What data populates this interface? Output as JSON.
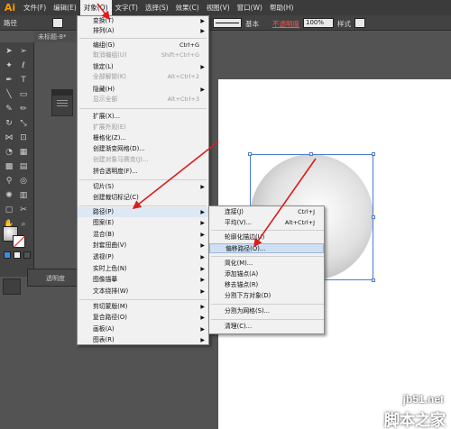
{
  "menubar": {
    "logo": "Ai",
    "items": [
      "文件(F)",
      "编辑(E)",
      "对象(O)",
      "文字(T)",
      "选择(S)",
      "效果(C)",
      "视图(V)",
      "窗口(W)",
      "帮助(H)"
    ]
  },
  "controlbar": {
    "path_label": "路径",
    "stroke_style": "基本",
    "opacity_label": "不透明度",
    "opacity_value": "100%",
    "style_label": "样式"
  },
  "doc_tab": "未标题-8*",
  "panels": {
    "transparency_tab": "透明度"
  },
  "object_menu": {
    "items": [
      {
        "label": "变换(T)",
        "shortcut": "",
        "submenu": true,
        "disabled": false
      },
      {
        "label": "排列(A)",
        "shortcut": "",
        "submenu": true,
        "disabled": false
      },
      {
        "label": "编组(G)",
        "shortcut": "Ctrl+G",
        "submenu": false,
        "disabled": false
      },
      {
        "label": "取消编组(U)",
        "shortcut": "Shift+Ctrl+G",
        "submenu": false,
        "disabled": true
      },
      {
        "label": "锁定(L)",
        "shortcut": "",
        "submenu": true,
        "disabled": false
      },
      {
        "label": "全部解锁(K)",
        "shortcut": "Alt+Ctrl+2",
        "submenu": false,
        "disabled": true
      },
      {
        "label": "隐藏(H)",
        "shortcut": "",
        "submenu": true,
        "disabled": false
      },
      {
        "label": "显示全部",
        "shortcut": "Alt+Ctrl+3",
        "submenu": false,
        "disabled": true
      },
      {
        "label": "扩展(X)...",
        "shortcut": "",
        "submenu": false,
        "disabled": false
      },
      {
        "label": "扩展外观(E)",
        "shortcut": "",
        "submenu": false,
        "disabled": true
      },
      {
        "label": "栅格化(Z)...",
        "shortcut": "",
        "submenu": false,
        "disabled": false
      },
      {
        "label": "创建渐变网格(D)...",
        "shortcut": "",
        "submenu": false,
        "disabled": false
      },
      {
        "label": "创建对象马赛克(J)...",
        "shortcut": "",
        "submenu": false,
        "disabled": true
      },
      {
        "label": "拼合透明度(F)...",
        "shortcut": "",
        "submenu": false,
        "disabled": false
      },
      {
        "label": "切片(S)",
        "shortcut": "",
        "submenu": true,
        "disabled": false
      },
      {
        "label": "创建裁切标记(C)",
        "shortcut": "",
        "submenu": false,
        "disabled": false
      },
      {
        "label": "路径(P)",
        "shortcut": "",
        "submenu": true,
        "disabled": false,
        "highlighted": true
      },
      {
        "label": "图案(E)",
        "shortcut": "",
        "submenu": true,
        "disabled": false
      },
      {
        "label": "混合(B)",
        "shortcut": "",
        "submenu": true,
        "disabled": false
      },
      {
        "label": "封套扭曲(V)",
        "shortcut": "",
        "submenu": true,
        "disabled": false
      },
      {
        "label": "透视(P)",
        "shortcut": "",
        "submenu": true,
        "disabled": false
      },
      {
        "label": "实时上色(N)",
        "shortcut": "",
        "submenu": true,
        "disabled": false
      },
      {
        "label": "图像描摹",
        "shortcut": "",
        "submenu": true,
        "disabled": false
      },
      {
        "label": "文本绕排(W)",
        "shortcut": "",
        "submenu": true,
        "disabled": false
      },
      {
        "label": "剪切蒙版(M)",
        "shortcut": "",
        "submenu": true,
        "disabled": false
      },
      {
        "label": "复合路径(O)",
        "shortcut": "",
        "submenu": true,
        "disabled": false
      },
      {
        "label": "画板(A)",
        "shortcut": "",
        "submenu": true,
        "disabled": false
      },
      {
        "label": "图表(R)",
        "shortcut": "",
        "submenu": true,
        "disabled": false
      }
    ]
  },
  "path_submenu": {
    "items": [
      {
        "label": "连接(J)",
        "shortcut": "Ctrl+J"
      },
      {
        "label": "平均(V)...",
        "shortcut": "Alt+Ctrl+J"
      },
      {
        "label": "轮廓化描边(U)",
        "shortcut": ""
      },
      {
        "label": "偏移路径(O)...",
        "shortcut": "",
        "highlighted": true
      },
      {
        "label": "简化(M)...",
        "shortcut": ""
      },
      {
        "label": "添加锚点(A)",
        "shortcut": ""
      },
      {
        "label": "移去锚点(R)",
        "shortcut": ""
      },
      {
        "label": "分割下方对象(D)",
        "shortcut": ""
      },
      {
        "label": "分割为网格(S)...",
        "shortcut": ""
      },
      {
        "label": "清理(C)...",
        "shortcut": ""
      }
    ]
  },
  "watermark": {
    "site": "jb51.net",
    "name": "脚本之家"
  },
  "colors": {
    "arrow": "#d81e1e",
    "selection": "#4a7ad6",
    "logo": "#ff9a00"
  }
}
